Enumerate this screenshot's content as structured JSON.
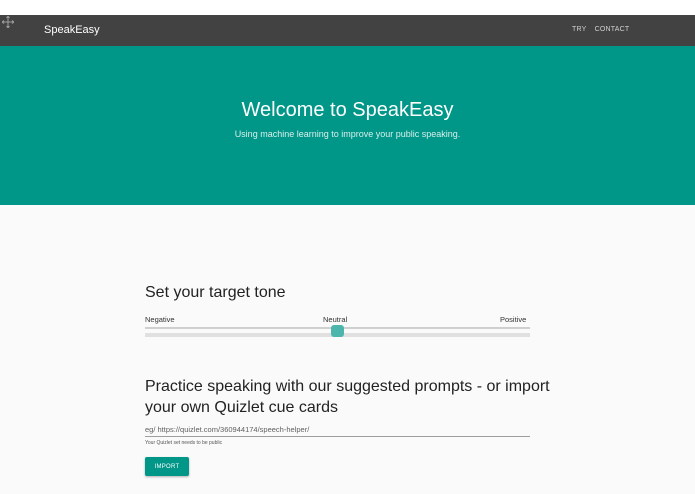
{
  "nav": {
    "brand": "SpeakEasy",
    "links": [
      "TRY",
      "CONTACT"
    ]
  },
  "hero": {
    "title": "Welcome to SpeakEasy",
    "subtitle": "Using machine learning to improve your public speaking."
  },
  "tone": {
    "title": "Set your target tone",
    "labels": {
      "negative": "Negative",
      "neutral": "Neutral",
      "positive": "Positive"
    },
    "slider_value": 0.5
  },
  "prompts": {
    "title": "Practice speaking with our suggested prompts - or import your own Quizlet cue cards",
    "input_placeholder": "eg/ https://quizlet.com/360944174/speech-helper/",
    "helper_text": "Your Quizlet set needs to be public",
    "import_label": "IMPORT"
  },
  "icons": {
    "top_left": "move-icon"
  },
  "colors": {
    "accent": "#009688",
    "navbar": "#424242",
    "thumb": "#4db6ac"
  }
}
